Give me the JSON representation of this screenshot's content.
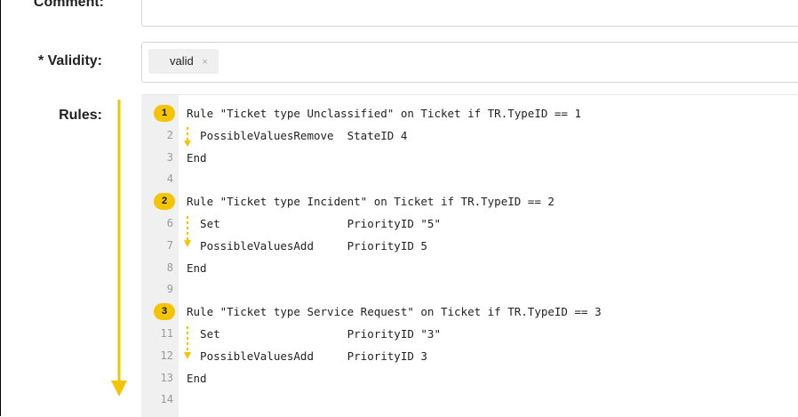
{
  "form": {
    "comment_label": "Comment:",
    "validity_label": "* Validity:",
    "validity_tag": "valid",
    "validity_tag_remove": "×",
    "rules_label": "Rules:"
  },
  "editor": {
    "lines": [
      {
        "num": "",
        "badge": "1",
        "code": "Rule \"Ticket type Unclassified\" on Ticket if TR.TypeID == 1"
      },
      {
        "num": "2",
        "badge": "",
        "code": "  PossibleValuesRemove  StateID 4"
      },
      {
        "num": "3",
        "badge": "",
        "code": "End"
      },
      {
        "num": "4",
        "badge": "",
        "code": ""
      },
      {
        "num": "",
        "badge": "2",
        "code": "Rule \"Ticket type Incident\" on Ticket if TR.TypeID == 2"
      },
      {
        "num": "6",
        "badge": "",
        "code": "  Set                   PriorityID \"5\""
      },
      {
        "num": "7",
        "badge": "",
        "code": "  PossibleValuesAdd     PriorityID 5"
      },
      {
        "num": "8",
        "badge": "",
        "code": "End"
      },
      {
        "num": "9",
        "badge": "",
        "code": ""
      },
      {
        "num": "",
        "badge": "3",
        "code": "Rule \"Ticket type Service Request\" on Ticket if TR.TypeID == 3"
      },
      {
        "num": "11",
        "badge": "",
        "code": "  Set                   PriorityID \"3\""
      },
      {
        "num": "12",
        "badge": "",
        "code": "  PossibleValuesAdd     PriorityID 3"
      },
      {
        "num": "13",
        "badge": "",
        "code": "End"
      },
      {
        "num": "14",
        "badge": "",
        "code": ""
      }
    ]
  },
  "colors": {
    "accent_yellow": "#f5c400",
    "gutter": "#f0f0f0"
  }
}
